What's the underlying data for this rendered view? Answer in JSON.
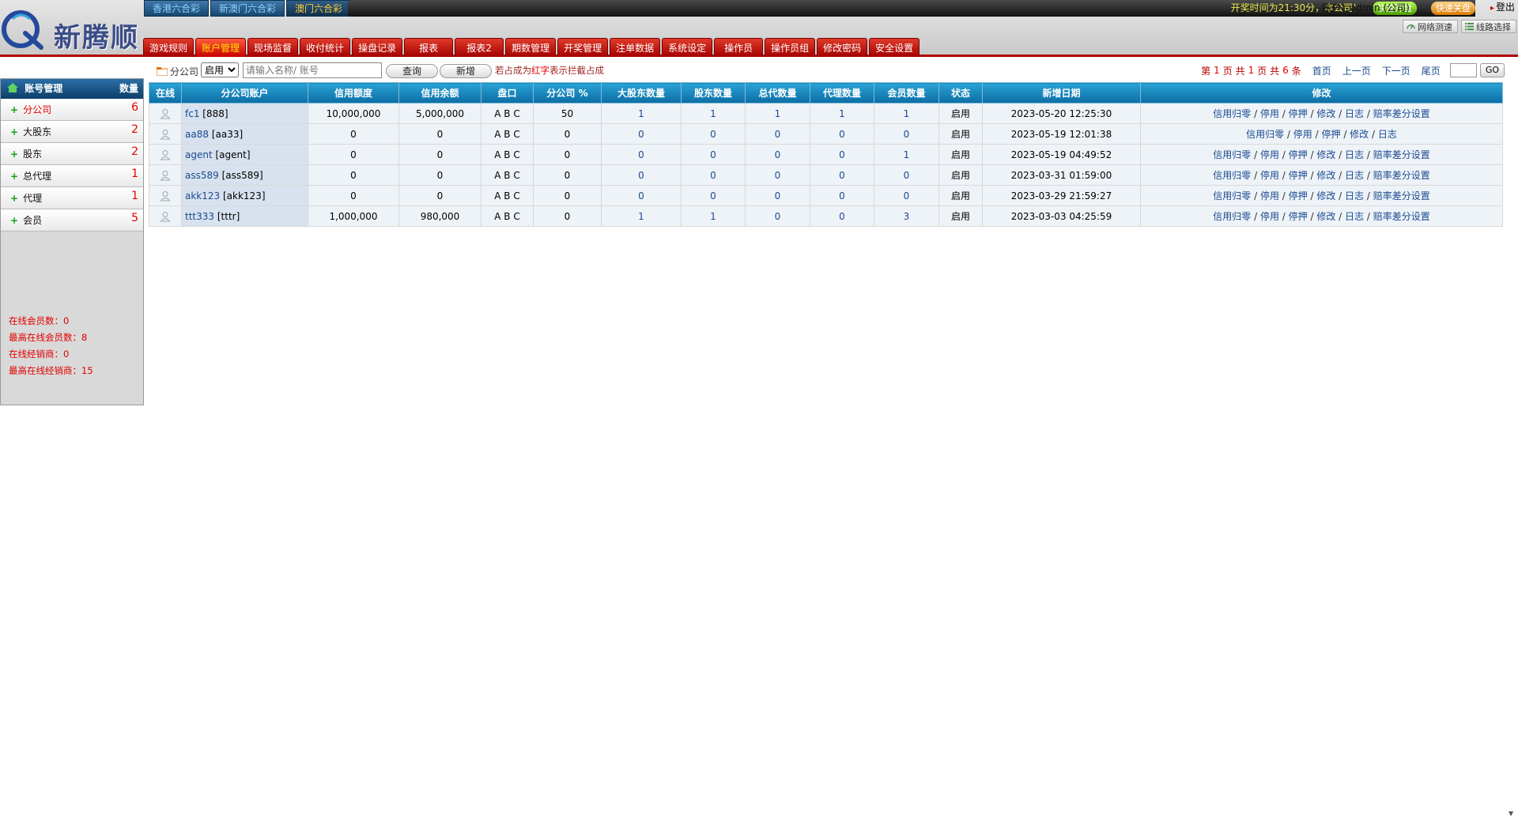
{
  "brand": {
    "name": "新腾顺"
  },
  "lottery_tabs": [
    {
      "label": "香港六合彩",
      "active": false
    },
    {
      "label": "新澳门六合彩",
      "active": false
    },
    {
      "label": "澳门六合彩",
      "active": true
    }
  ],
  "topbar": {
    "ticker": "开奖时间为21:30分，本公司!",
    "quick_open": "快速开盘",
    "quick_close": "快速关盘",
    "account": "账户：admin (公司)",
    "logout": "登出",
    "net_test": "网络测速",
    "line_select": "线路选择"
  },
  "nav": [
    {
      "label": "游戏规则",
      "active": false
    },
    {
      "label": "账户管理",
      "active": true
    },
    {
      "label": "现场监督",
      "active": false
    },
    {
      "label": "收付统计",
      "active": false
    },
    {
      "label": "操盘记录",
      "active": false
    },
    {
      "label": "报表",
      "active": false
    },
    {
      "label": "报表2",
      "active": false
    },
    {
      "label": "期数管理",
      "active": false
    },
    {
      "label": "开奖管理",
      "active": false
    },
    {
      "label": "注单数据",
      "active": false
    },
    {
      "label": "系统设定",
      "active": false
    },
    {
      "label": "操作员",
      "active": false
    },
    {
      "label": "操作员组",
      "active": false
    },
    {
      "label": "修改密码",
      "active": false
    },
    {
      "label": "安全设置",
      "active": false
    }
  ],
  "sidebar": {
    "title": "账号管理",
    "count_header": "数量",
    "items": [
      {
        "label": "分公司",
        "count": "6",
        "active": true
      },
      {
        "label": "大股东",
        "count": "2",
        "active": false
      },
      {
        "label": "股东",
        "count": "2",
        "active": false
      },
      {
        "label": "总代理",
        "count": "1",
        "active": false
      },
      {
        "label": "代理",
        "count": "1",
        "active": false
      },
      {
        "label": "会员",
        "count": "5",
        "active": false
      }
    ],
    "stats": [
      "在线会员数：0",
      "最高在线会员数：8",
      "在线经销商：0",
      "最高在线经销商：15"
    ]
  },
  "toolbar": {
    "label": "分公司",
    "status_selected": "启用",
    "search_placeholder": "请输入名称/ 账号",
    "query": "查询",
    "add": "新增",
    "note_prefix": "若占成为",
    "note_red": "红字",
    "note_suffix": "表示拦截占成"
  },
  "pager": {
    "t1": "第",
    "page": "1",
    "t2": "页 共",
    "total_pages": "1",
    "t3": "页 共",
    "total_rows": "6",
    "t4": "条",
    "first": "首页",
    "prev": "上一页",
    "next": "下一页",
    "last": "尾页",
    "go": "GO"
  },
  "table": {
    "headers": [
      "在线",
      "分公司账户",
      "信用额度",
      "信用余额",
      "盘口",
      "分公司 %",
      "大股东数量",
      "股东数量",
      "总代数量",
      "代理数量",
      "会员数量",
      "状态",
      "新增日期",
      "修改"
    ],
    "rows": [
      {
        "account": "fc1",
        "alias": "[888]",
        "credit": "10,000,000",
        "balance": "5,000,000",
        "pan": "A B C",
        "pct": "50",
        "big": "1",
        "sh": "1",
        "gen": "1",
        "agent": "1",
        "member": "1",
        "status": "启用",
        "date": "2023-05-20 12:25:30",
        "actions": [
          "信用归零",
          "停用",
          "停押",
          "修改",
          "日志",
          "赔率差分设置"
        ]
      },
      {
        "account": "aa88",
        "alias": "[aa33]",
        "credit": "0",
        "balance": "0",
        "pan": "A B C",
        "pct": "0",
        "big": "0",
        "sh": "0",
        "gen": "0",
        "agent": "0",
        "member": "0",
        "status": "启用",
        "date": "2023-05-19 12:01:38",
        "actions": [
          "信用归零",
          "停用",
          "停押",
          "修改",
          "日志"
        ]
      },
      {
        "account": "agent",
        "alias": "[agent]",
        "credit": "0",
        "balance": "0",
        "pan": "A B C",
        "pct": "0",
        "big": "0",
        "sh": "0",
        "gen": "0",
        "agent": "0",
        "member": "1",
        "status": "启用",
        "date": "2023-05-19 04:49:52",
        "actions": [
          "信用归零",
          "停用",
          "停押",
          "修改",
          "日志",
          "赔率差分设置"
        ]
      },
      {
        "account": "ass589",
        "alias": "[ass589]",
        "credit": "0",
        "balance": "0",
        "pan": "A B C",
        "pct": "0",
        "big": "0",
        "sh": "0",
        "gen": "0",
        "agent": "0",
        "member": "0",
        "status": "启用",
        "date": "2023-03-31 01:59:00",
        "actions": [
          "信用归零",
          "停用",
          "停押",
          "修改",
          "日志",
          "赔率差分设置"
        ]
      },
      {
        "account": "akk123",
        "alias": "[akk123]",
        "credit": "0",
        "balance": "0",
        "pan": "A B C",
        "pct": "0",
        "big": "0",
        "sh": "0",
        "gen": "0",
        "agent": "0",
        "member": "0",
        "status": "启用",
        "date": "2023-03-29 21:59:27",
        "actions": [
          "信用归零",
          "停用",
          "停押",
          "修改",
          "日志",
          "赔率差分设置"
        ]
      },
      {
        "account": "ttt333",
        "alias": "[tttr]",
        "credit": "1,000,000",
        "balance": "980,000",
        "pan": "A B C",
        "pct": "0",
        "big": "1",
        "sh": "1",
        "gen": "0",
        "agent": "0",
        "member": "3",
        "status": "启用",
        "date": "2023-03-03 04:25:59",
        "actions": [
          "信用归零",
          "停用",
          "停押",
          "修改",
          "日志",
          "赔率差分设置"
        ]
      }
    ]
  }
}
